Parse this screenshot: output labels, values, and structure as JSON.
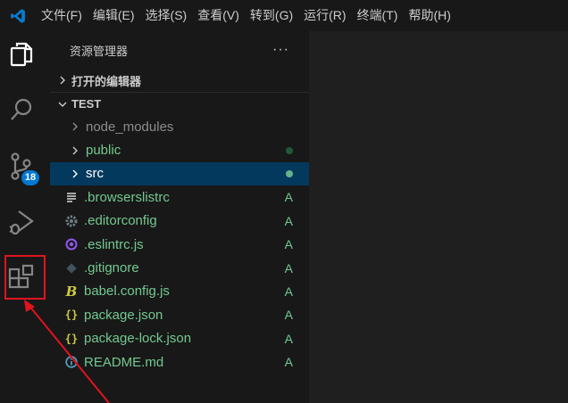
{
  "menubar": {
    "items": [
      "文件(F)",
      "编辑(E)",
      "选择(S)",
      "查看(V)",
      "转到(G)",
      "运行(R)",
      "终端(T)",
      "帮助(H)"
    ]
  },
  "activitybar": {
    "items": [
      {
        "name": "explorer",
        "icon": "files-icon"
      },
      {
        "name": "search",
        "icon": "search-icon"
      },
      {
        "name": "source-control",
        "icon": "source-control-icon",
        "badge": "18"
      },
      {
        "name": "run-debug",
        "icon": "run-debug-icon"
      },
      {
        "name": "extensions",
        "icon": "extensions-icon"
      }
    ]
  },
  "sidebar": {
    "title": "资源管理器",
    "more": "···",
    "open_editors": "打开的编辑器",
    "project": "TEST",
    "tree": [
      {
        "label": "node_modules",
        "type": "folder",
        "color": "#8c8c8c"
      },
      {
        "label": "public",
        "type": "folder",
        "color": "#73c991",
        "status": "dot",
        "dot_color": "#1e5a37"
      },
      {
        "label": "src",
        "type": "folder",
        "color": "#cccccc",
        "status": "dot",
        "dot_color": "#73c991",
        "selected": true
      },
      {
        "label": ".browserslistrc",
        "type": "file",
        "icon": "lines-icon",
        "color": "#73c991",
        "status": "A"
      },
      {
        "label": ".editorconfig",
        "type": "file",
        "icon": "gear-icon",
        "color": "#73c991",
        "status": "A"
      },
      {
        "label": ".eslintrc.js",
        "type": "file",
        "icon": "eslint-icon",
        "color": "#73c991",
        "status": "A"
      },
      {
        "label": ".gitignore",
        "type": "file",
        "icon": "git-icon",
        "color": "#73c991",
        "status": "A"
      },
      {
        "label": "babel.config.js",
        "type": "file",
        "icon": "babel-icon",
        "color": "#73c991",
        "status": "A"
      },
      {
        "label": "package.json",
        "type": "file",
        "icon": "json-icon",
        "color": "#73c991",
        "status": "A"
      },
      {
        "label": "package-lock.json",
        "type": "file",
        "icon": "json-icon",
        "color": "#73c991",
        "status": "A"
      },
      {
        "label": "README.md",
        "type": "file",
        "icon": "info-icon",
        "color": "#73c991",
        "status": "A"
      }
    ]
  },
  "colors": {
    "background": "#181818",
    "editor_background": "#1f1f1f",
    "accent": "#0078d4",
    "added": "#73c991",
    "annotation": "#e0141e"
  }
}
